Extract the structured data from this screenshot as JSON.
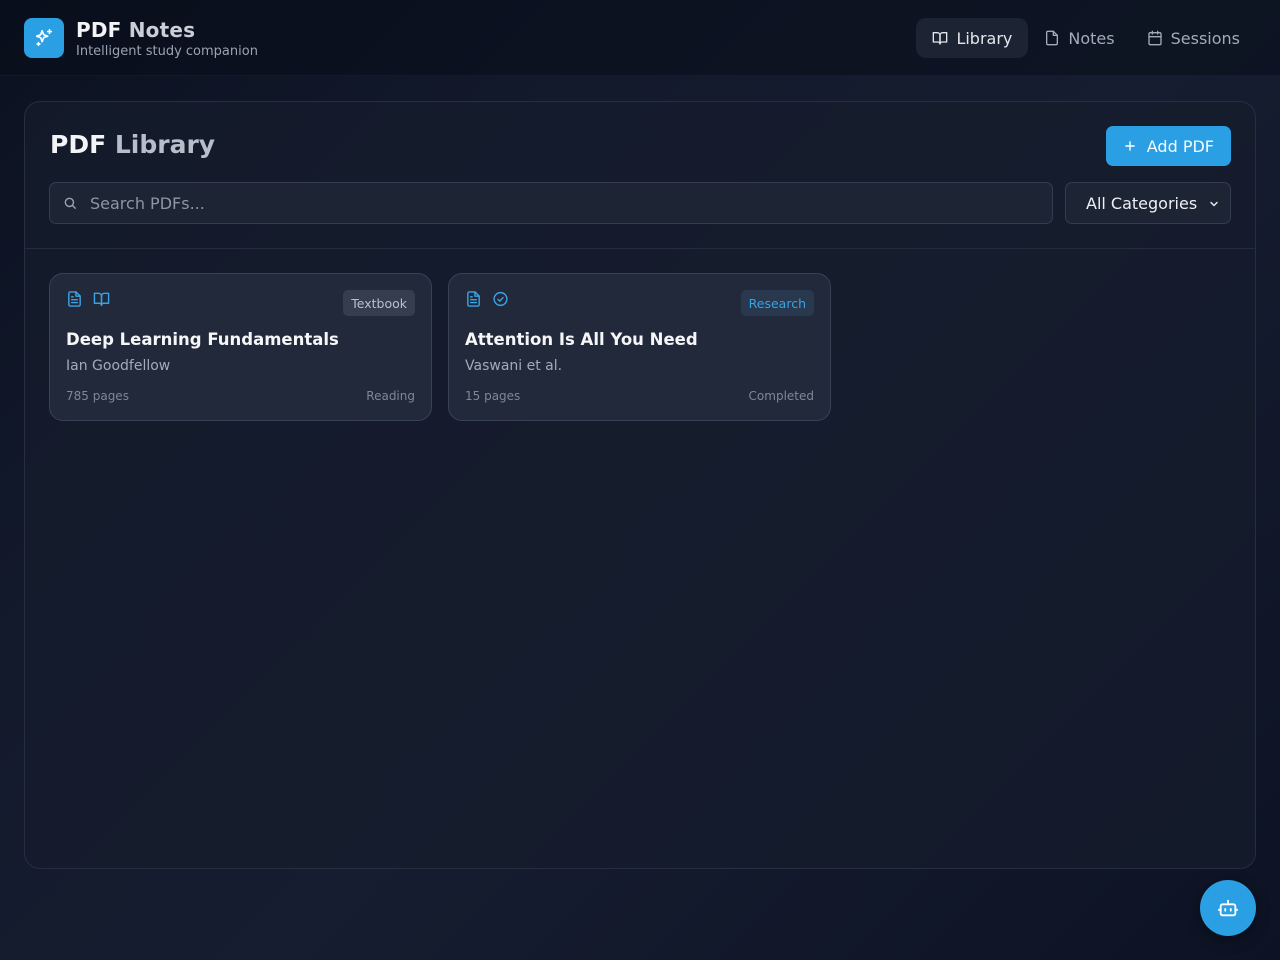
{
  "app": {
    "brand_main": "PDF",
    "brand_accent": "Notes",
    "subtitle": "Intelligent study companion",
    "logo_icon": "sparkles-icon"
  },
  "nav": [
    {
      "label": "Library",
      "icon": "book-open-icon",
      "active": true
    },
    {
      "label": "Notes",
      "icon": "file-icon",
      "active": false
    },
    {
      "label": "Sessions",
      "icon": "calendar-icon",
      "active": false
    }
  ],
  "library": {
    "title_main": "PDF",
    "title_accent": "Library",
    "add_button": "Add PDF",
    "search_placeholder": "Search PDFs...",
    "category_selected": "All Categories"
  },
  "pdfs": [
    {
      "title": "Deep Learning Fundamentals",
      "author": "Ian Goodfellow",
      "pages": "785 pages",
      "status": "Reading",
      "category": "Textbook",
      "status_icon": "book-open-icon"
    },
    {
      "title": "Attention Is All You Need",
      "author": "Vaswani et al.",
      "pages": "15 pages",
      "status": "Completed",
      "category": "Research",
      "status_icon": "check-circle-icon"
    }
  ],
  "colors": {
    "accent": "#2a9fe4",
    "background": "#111827",
    "panel": "#161c2c"
  },
  "fab_icon": "bot-icon"
}
